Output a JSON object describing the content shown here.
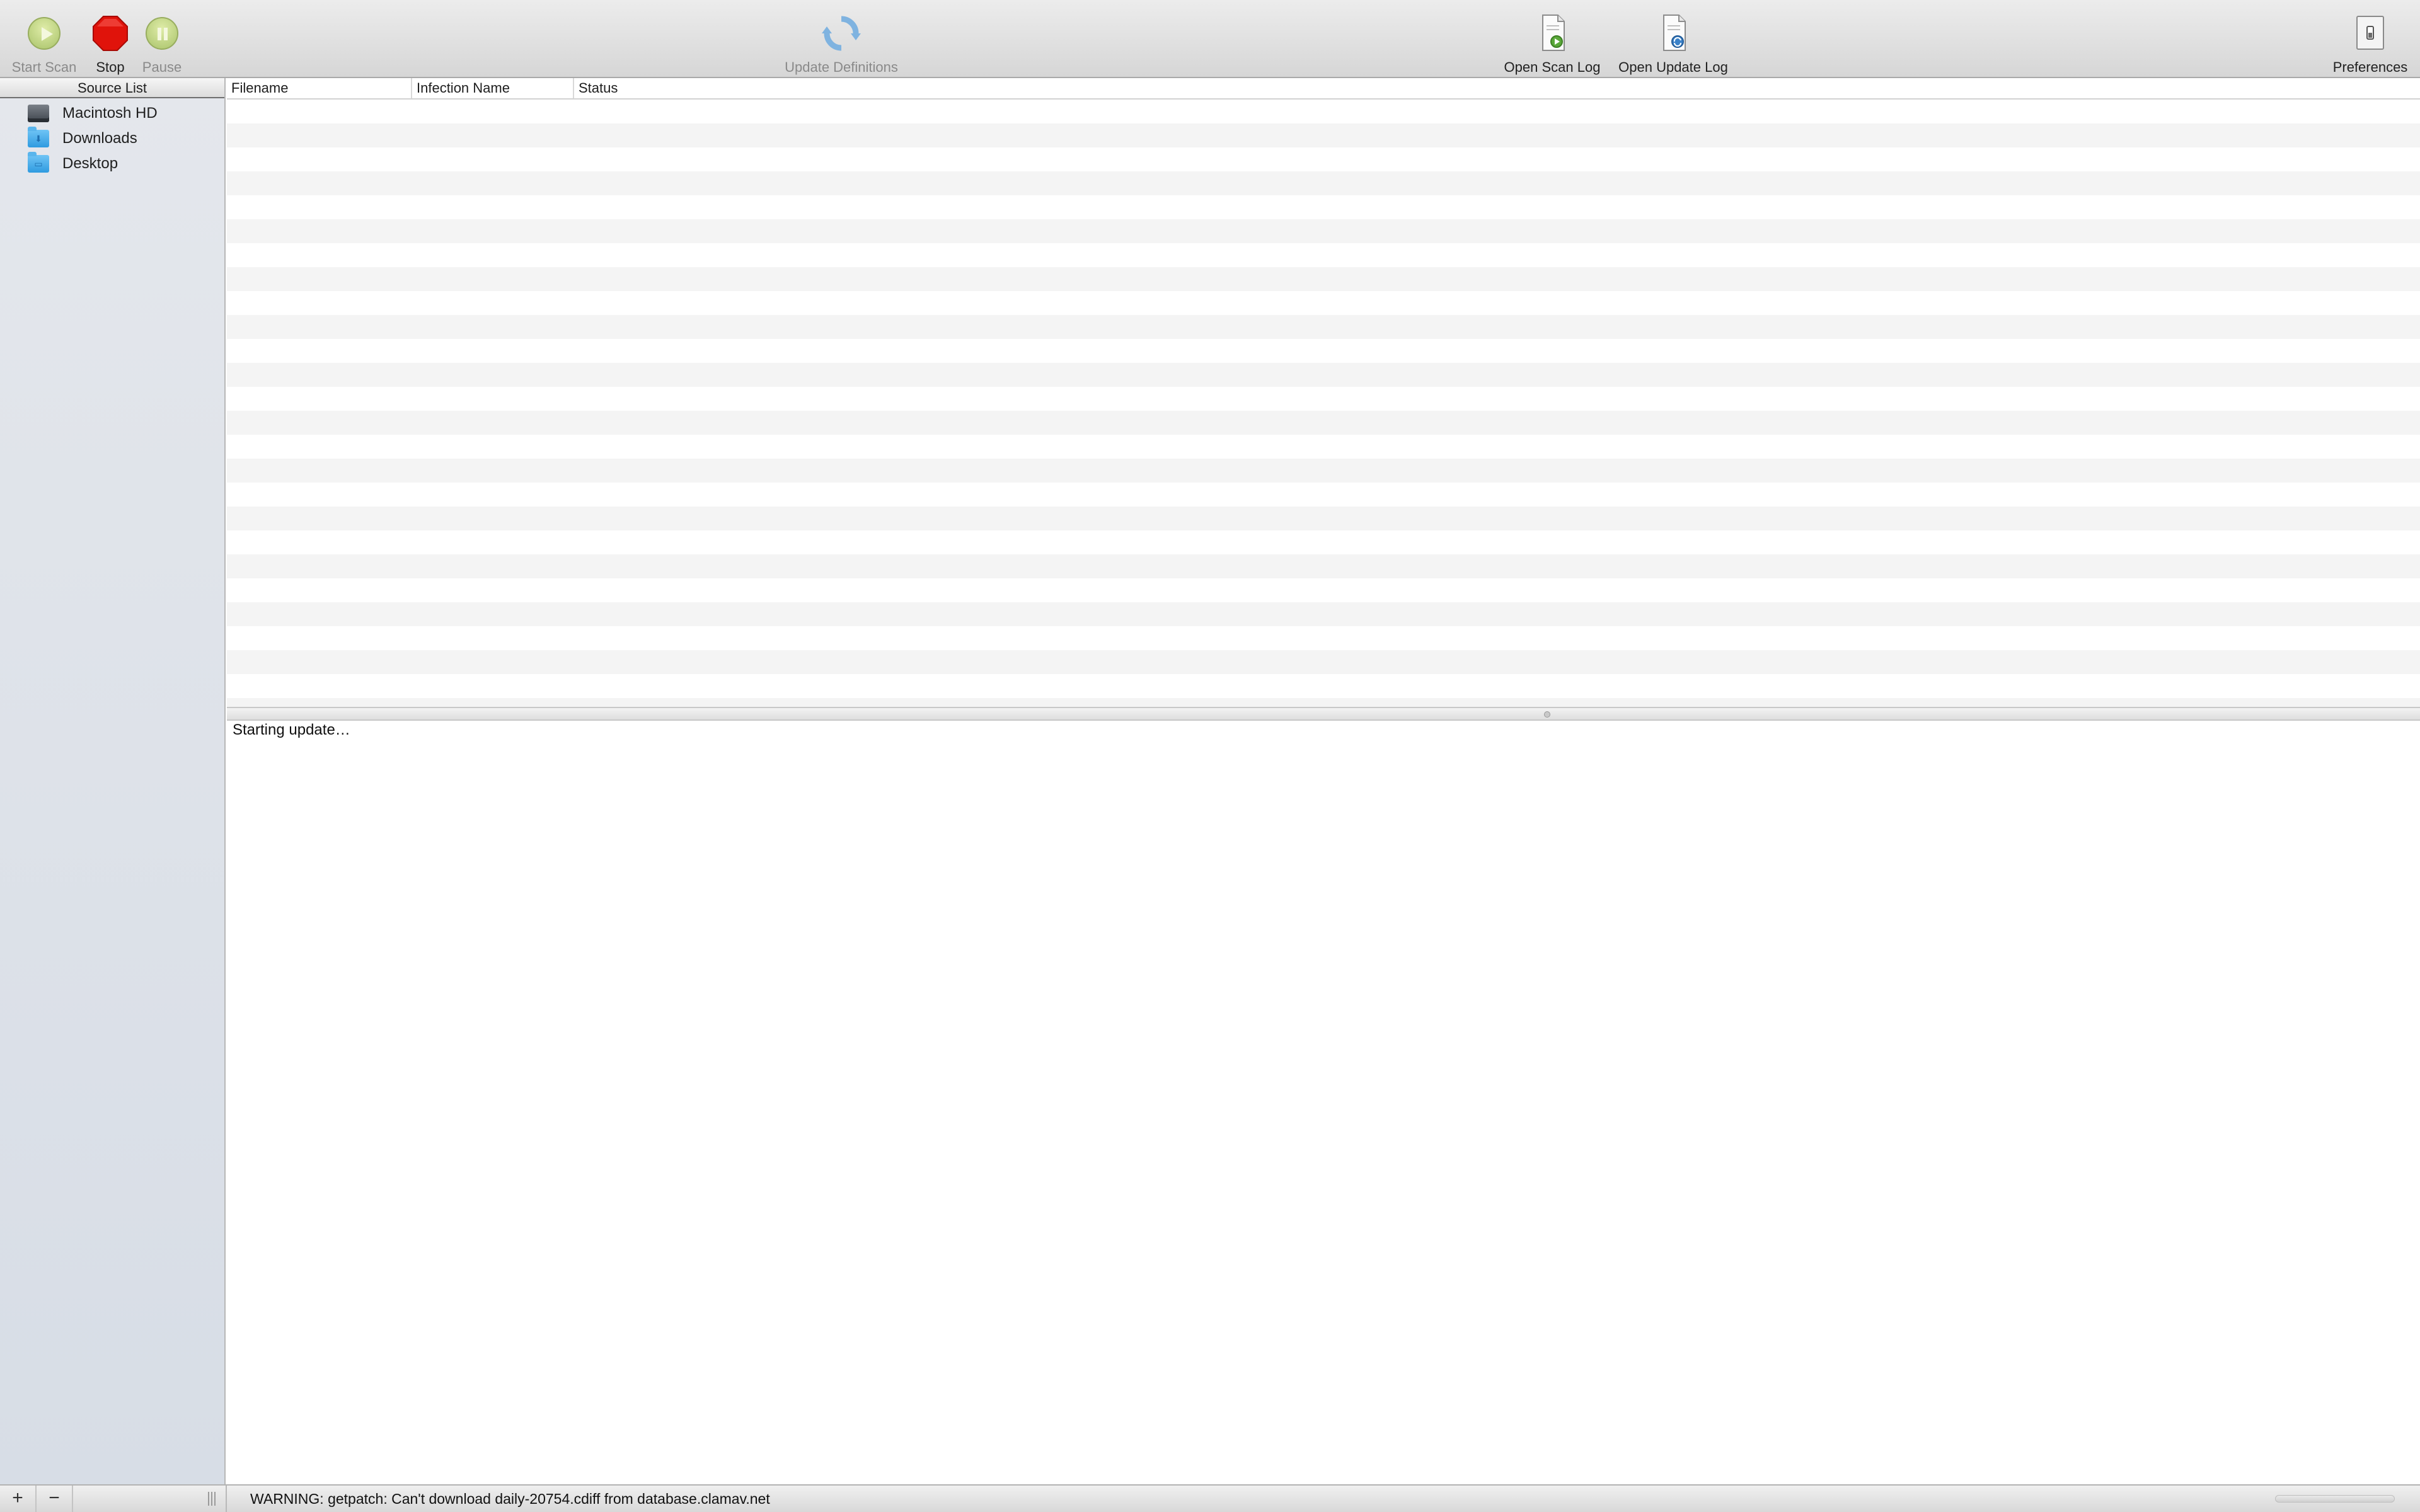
{
  "toolbar": {
    "start_scan": "Start Scan",
    "stop": "Stop",
    "pause": "Pause",
    "update_definitions": "Update Definitions",
    "open_scan_log": "Open Scan Log",
    "open_update_log": "Open Update Log",
    "preferences": "Preferences"
  },
  "sidebar": {
    "header": "Source List",
    "items": [
      {
        "label": "Macintosh HD",
        "icon": "hard-drive-icon"
      },
      {
        "label": "Downloads",
        "icon": "downloads-folder-icon"
      },
      {
        "label": "Desktop",
        "icon": "desktop-folder-icon"
      }
    ]
  },
  "table": {
    "columns": [
      "Filename",
      "Infection Name",
      "Status"
    ],
    "rows": []
  },
  "log": {
    "text": "Starting update…"
  },
  "status_bar": {
    "add_label": "+",
    "remove_label": "−",
    "message": "WARNING: getpatch: Can't download daily-20754.cdiff from database.clamav.net"
  },
  "colors": {
    "stop_red": "#e0130b",
    "start_green": "#b8cf78",
    "folder_blue": "#3fa7ea"
  }
}
